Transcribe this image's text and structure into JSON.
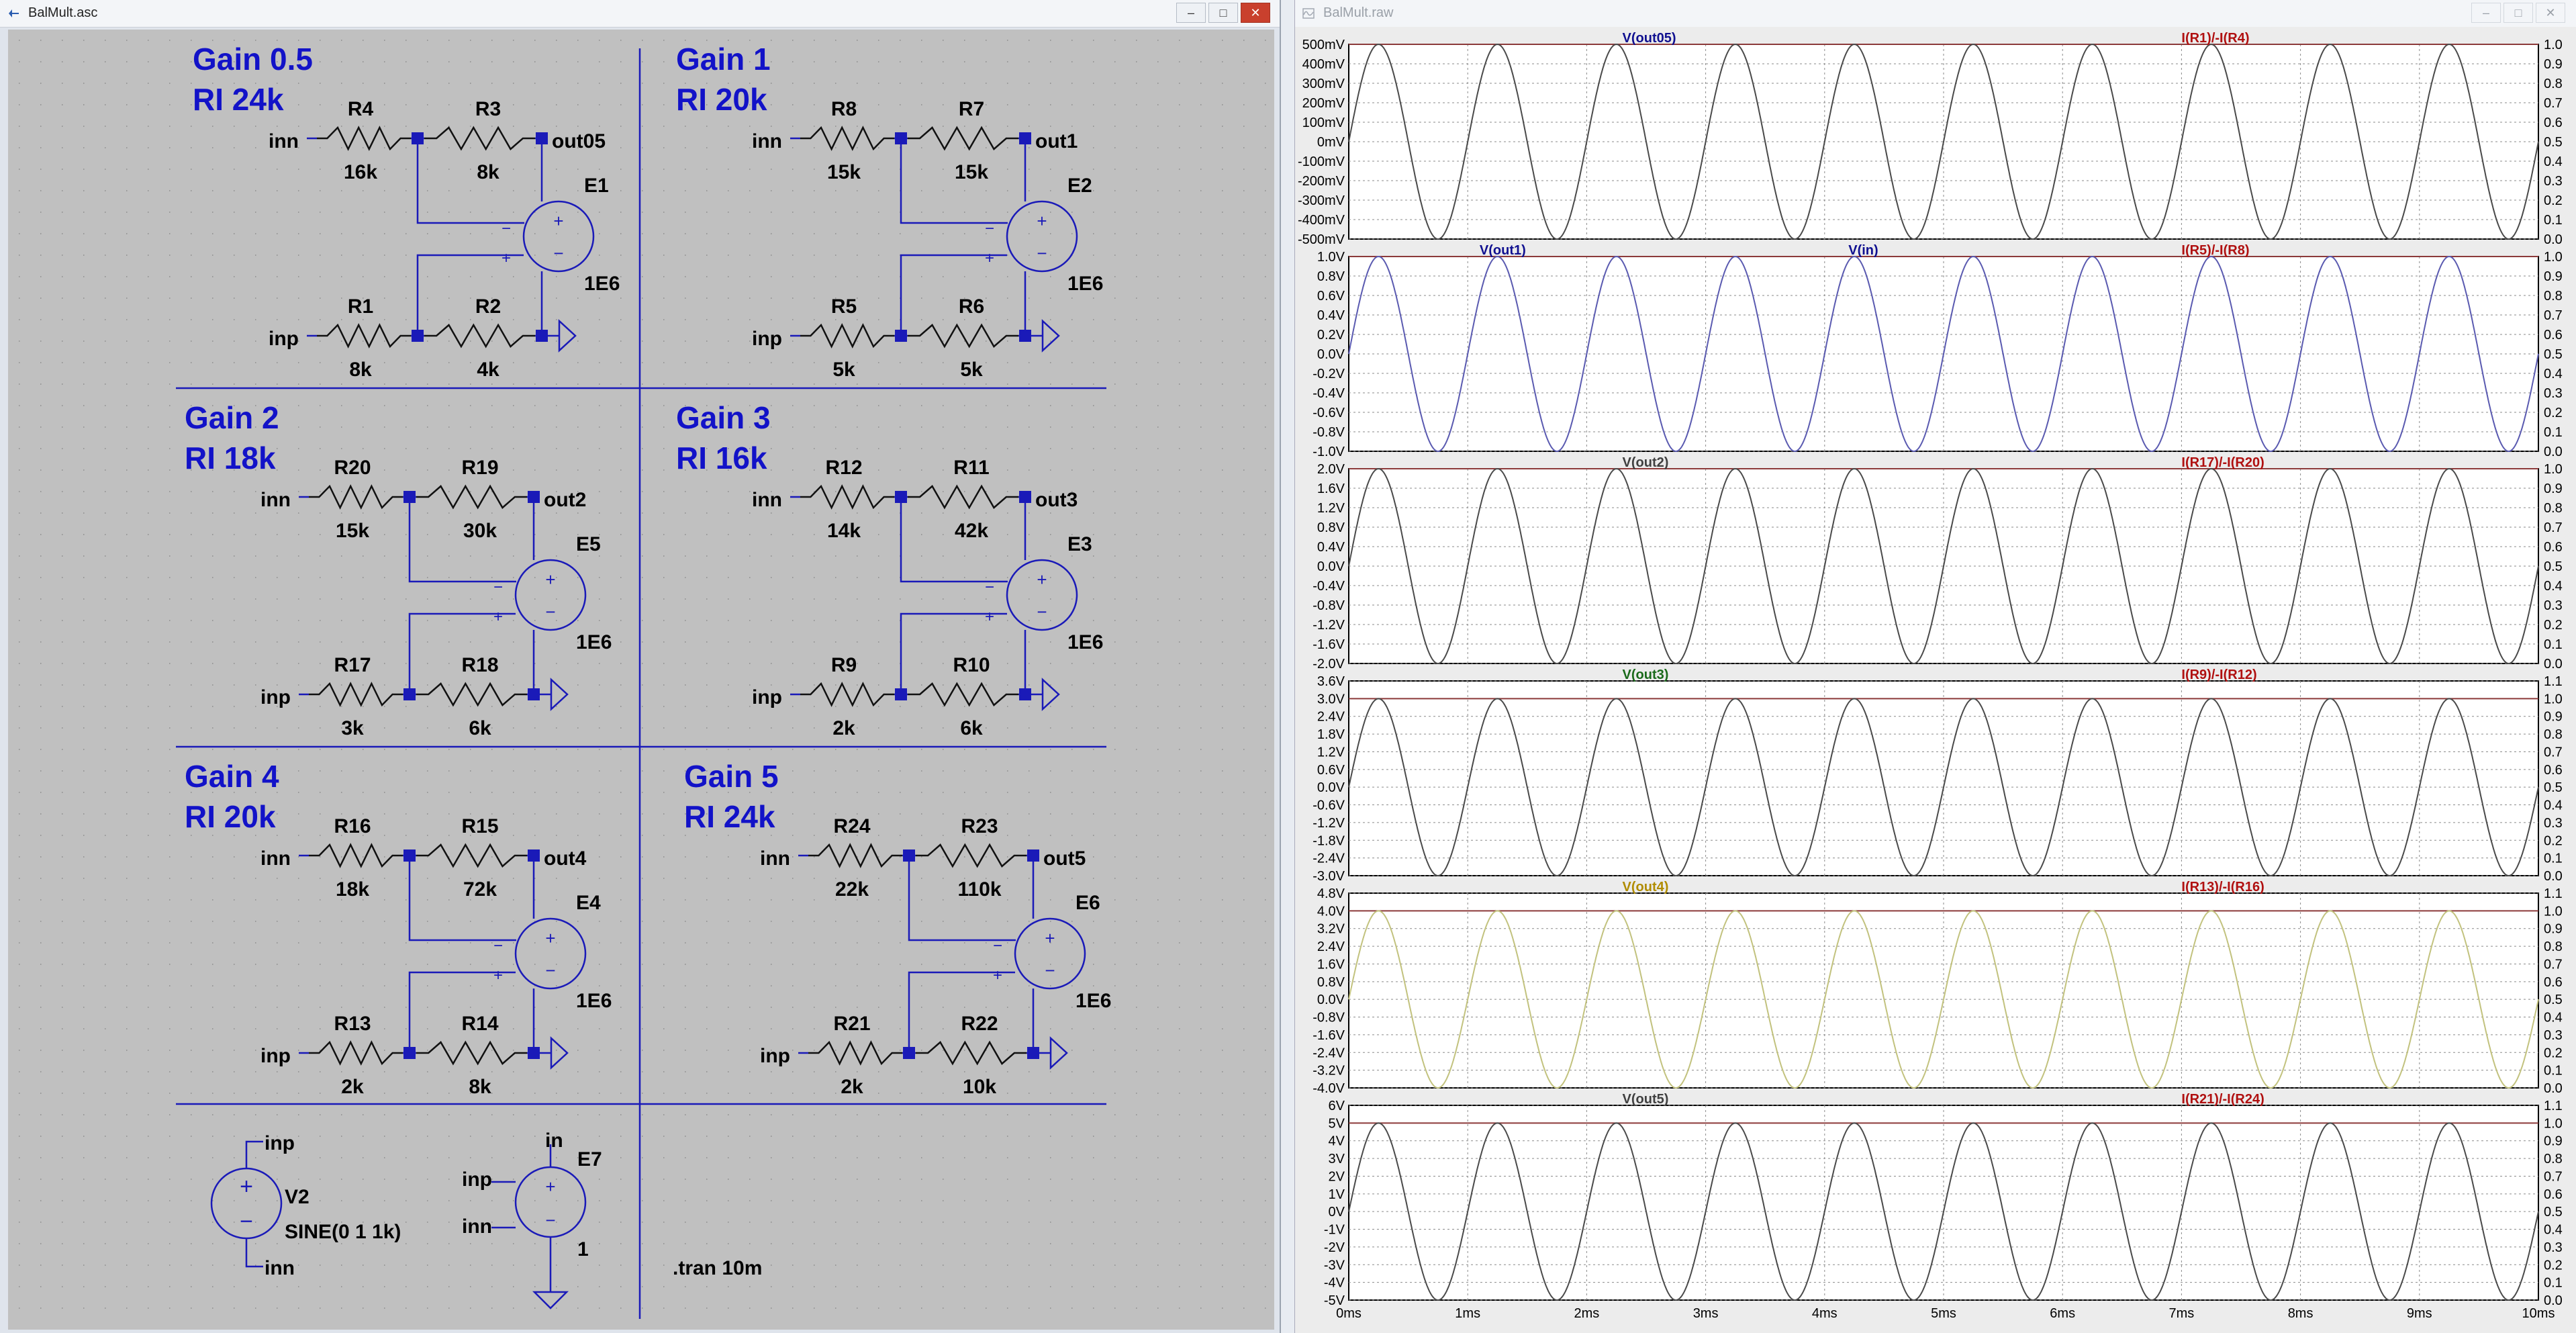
{
  "schematic_window": {
    "title": "BalMult.asc",
    "buttons": {
      "minimize": "–",
      "maximize": "□",
      "close": "✕"
    }
  },
  "plot_window": {
    "title": "BalMult.raw",
    "buttons": {
      "minimize": "–",
      "maximize": "□",
      "close": "✕"
    }
  },
  "schematic": {
    "cells": [
      {
        "gain": "Gain 0.5",
        "ri": "RI 24k",
        "top_in": "inn",
        "bot_in": "inp",
        "out": "out05",
        "amp": "E1",
        "amp_gain": "1E6",
        "r_top_in": {
          "name": "R4",
          "value": "16k"
        },
        "r_top_fb": {
          "name": "R3",
          "value": "8k"
        },
        "r_bot_in": {
          "name": "R1",
          "value": "8k"
        },
        "r_bot_gnd": {
          "name": "R2",
          "value": "4k"
        }
      },
      {
        "gain": "Gain 1",
        "ri": "RI 20k",
        "top_in": "inn",
        "bot_in": "inp",
        "out": "out1",
        "amp": "E2",
        "amp_gain": "1E6",
        "r_top_in": {
          "name": "R8",
          "value": "15k"
        },
        "r_top_fb": {
          "name": "R7",
          "value": "15k"
        },
        "r_bot_in": {
          "name": "R5",
          "value": "5k"
        },
        "r_bot_gnd": {
          "name": "R6",
          "value": "5k"
        }
      },
      {
        "gain": "Gain 2",
        "ri": "RI 18k",
        "top_in": "inn",
        "bot_in": "inp",
        "out": "out2",
        "amp": "E5",
        "amp_gain": "1E6",
        "r_top_in": {
          "name": "R20",
          "value": "15k"
        },
        "r_top_fb": {
          "name": "R19",
          "value": "30k"
        },
        "r_bot_in": {
          "name": "R17",
          "value": "3k"
        },
        "r_bot_gnd": {
          "name": "R18",
          "value": "6k"
        }
      },
      {
        "gain": "Gain 3",
        "ri": "RI 16k",
        "top_in": "inn",
        "bot_in": "inp",
        "out": "out3",
        "amp": "E3",
        "amp_gain": "1E6",
        "r_top_in": {
          "name": "R12",
          "value": "14k"
        },
        "r_top_fb": {
          "name": "R11",
          "value": "42k"
        },
        "r_bot_in": {
          "name": "R9",
          "value": "2k"
        },
        "r_bot_gnd": {
          "name": "R10",
          "value": "6k"
        }
      },
      {
        "gain": "Gain 4",
        "ri": "RI 20k",
        "top_in": "inn",
        "bot_in": "inp",
        "out": "out4",
        "amp": "E4",
        "amp_gain": "1E6",
        "r_top_in": {
          "name": "R16",
          "value": "18k"
        },
        "r_top_fb": {
          "name": "R15",
          "value": "72k"
        },
        "r_bot_in": {
          "name": "R13",
          "value": "2k"
        },
        "r_bot_gnd": {
          "name": "R14",
          "value": "8k"
        }
      },
      {
        "gain": "Gain 5",
        "ri": "RI 24k",
        "top_in": "inn",
        "bot_in": "inp",
        "out": "out5",
        "amp": "E6",
        "amp_gain": "1E6",
        "r_top_in": {
          "name": "R24",
          "value": "22k"
        },
        "r_top_fb": {
          "name": "R23",
          "value": "110k"
        },
        "r_bot_in": {
          "name": "R21",
          "value": "2k"
        },
        "r_bot_gnd": {
          "name": "R22",
          "value": "10k"
        }
      }
    ],
    "source": {
      "name": "V2",
      "value": "SINE(0 1 1k)",
      "top_net": "inp",
      "bot_net": "inn"
    },
    "e7": {
      "name": "E7",
      "gain": "1",
      "out_net": "in",
      "in_plus": "inp",
      "in_minus": "inn"
    },
    "directive": ".tran 10m",
    "amp_plus": "+",
    "amp_minus": "−"
  },
  "colors": {
    "schematic_bg": "#c0c0c0",
    "wire": "#1a1ab8",
    "label_blue": "#1212c8",
    "text_black": "#000000",
    "plot_bg": "#ffffff",
    "trace_dark": "#4a4a4a",
    "trace_blue": "#5a5ab0",
    "trace_olive": "#c2c27e",
    "current_trace": "#8c3a3a",
    "current_label": "#b01010"
  },
  "chart_data": [
    {
      "type": "line",
      "panel": 1,
      "traces": [
        {
          "label": "V(out05)",
          "color": "#101090"
        }
      ],
      "right_trace": {
        "label": "I(R1)/-I(R4)",
        "value": 1.0
      },
      "yticks": [
        "500mV",
        "400mV",
        "300mV",
        "200mV",
        "100mV",
        "0mV",
        "-100mV",
        "-200mV",
        "-300mV",
        "-400mV",
        "-500mV"
      ],
      "ylim": [
        -0.5,
        0.5
      ],
      "amplitude": 0.5,
      "frequency_hz": 1000,
      "right_ticks": [
        "1.0",
        "0.9",
        "0.8",
        "0.7",
        "0.6",
        "0.5",
        "0.4",
        "0.3",
        "0.2",
        "0.1",
        "0.0"
      ],
      "trace_color": "#4a4a4a"
    },
    {
      "type": "line",
      "panel": 2,
      "traces": [
        {
          "label": "V(out1)",
          "color": "#101090"
        },
        {
          "label": "V(in)",
          "color": "#101090"
        }
      ],
      "right_trace": {
        "label": "I(R5)/-I(R8)",
        "value": 1.0
      },
      "yticks": [
        "1.0V",
        "0.8V",
        "0.6V",
        "0.4V",
        "0.2V",
        "0.0V",
        "-0.2V",
        "-0.4V",
        "-0.6V",
        "-0.8V",
        "-1.0V"
      ],
      "ylim": [
        -1.0,
        1.0
      ],
      "amplitude": 1.0,
      "frequency_hz": 1000,
      "right_ticks": [
        "1.0",
        "0.9",
        "0.8",
        "0.7",
        "0.6",
        "0.5",
        "0.4",
        "0.3",
        "0.2",
        "0.1",
        "0.0"
      ],
      "trace_color": "#5a5ab0"
    },
    {
      "type": "line",
      "panel": 3,
      "traces": [
        {
          "label": "V(out2)",
          "color": "#404040"
        }
      ],
      "right_trace": {
        "label": "I(R17)/-I(R20)",
        "value": 1.0
      },
      "yticks": [
        "2.0V",
        "1.6V",
        "1.2V",
        "0.8V",
        "0.4V",
        "0.0V",
        "-0.4V",
        "-0.8V",
        "-1.2V",
        "-1.6V",
        "-2.0V"
      ],
      "ylim": [
        -2.0,
        2.0
      ],
      "amplitude": 2.0,
      "frequency_hz": 1000,
      "right_ticks": [
        "1.0",
        "0.9",
        "0.8",
        "0.7",
        "0.6",
        "0.5",
        "0.4",
        "0.3",
        "0.2",
        "0.1",
        "0.0"
      ],
      "trace_color": "#4a4a4a"
    },
    {
      "type": "line",
      "panel": 4,
      "traces": [
        {
          "label": "V(out3)",
          "color": "#1a6a1a"
        }
      ],
      "right_trace": {
        "label": "I(R9)/-I(R12)",
        "value": 1.0
      },
      "yticks": [
        "3.6V",
        "3.0V",
        "2.4V",
        "1.8V",
        "1.2V",
        "0.6V",
        "0.0V",
        "-0.6V",
        "-1.2V",
        "-1.8V",
        "-2.4V",
        "-3.0V"
      ],
      "ylim": [
        -3.0,
        3.6
      ],
      "amplitude": 3.0,
      "frequency_hz": 1000,
      "right_ticks": [
        "1.1",
        "1.0",
        "0.9",
        "0.8",
        "0.7",
        "0.6",
        "0.5",
        "0.4",
        "0.3",
        "0.2",
        "0.1",
        "0.0"
      ],
      "trace_color": "#4a4a4a"
    },
    {
      "type": "line",
      "panel": 5,
      "traces": [
        {
          "label": "V(out4)",
          "color": "#b08c00"
        }
      ],
      "right_trace": {
        "label": "I(R13)/-I(R16)",
        "value": 1.0
      },
      "yticks": [
        "4.8V",
        "4.0V",
        "3.2V",
        "2.4V",
        "1.6V",
        "0.8V",
        "0.0V",
        "-0.8V",
        "-1.6V",
        "-2.4V",
        "-3.2V",
        "-4.0V"
      ],
      "ylim": [
        -4.0,
        4.8
      ],
      "amplitude": 4.0,
      "frequency_hz": 1000,
      "right_ticks": [
        "1.1",
        "1.0",
        "0.9",
        "0.8",
        "0.7",
        "0.6",
        "0.5",
        "0.4",
        "0.3",
        "0.2",
        "0.1",
        "0.0"
      ],
      "trace_color": "#c2c27e"
    },
    {
      "type": "line",
      "panel": 6,
      "traces": [
        {
          "label": "V(out5)",
          "color": "#404040"
        }
      ],
      "right_trace": {
        "label": "I(R21)/-I(R24)",
        "value": 1.0
      },
      "yticks": [
        "6V",
        "5V",
        "4V",
        "3V",
        "2V",
        "1V",
        "0V",
        "-1V",
        "-2V",
        "-3V",
        "-4V",
        "-5V"
      ],
      "ylim": [
        -5,
        6
      ],
      "amplitude": 5.0,
      "frequency_hz": 1000,
      "right_ticks": [
        "1.1",
        "1.0",
        "0.9",
        "0.8",
        "0.7",
        "0.6",
        "0.5",
        "0.4",
        "0.3",
        "0.2",
        "0.1",
        "0.0"
      ],
      "trace_color": "#4a4a4a",
      "xticks": [
        "0ms",
        "1ms",
        "2ms",
        "3ms",
        "4ms",
        "5ms",
        "6ms",
        "7ms",
        "8ms",
        "9ms",
        "10ms"
      ]
    }
  ],
  "x_axis": {
    "range_ms": [
      0,
      10
    ],
    "ticks": [
      "0ms",
      "1ms",
      "2ms",
      "3ms",
      "4ms",
      "5ms",
      "6ms",
      "7ms",
      "8ms",
      "9ms",
      "10ms"
    ]
  }
}
